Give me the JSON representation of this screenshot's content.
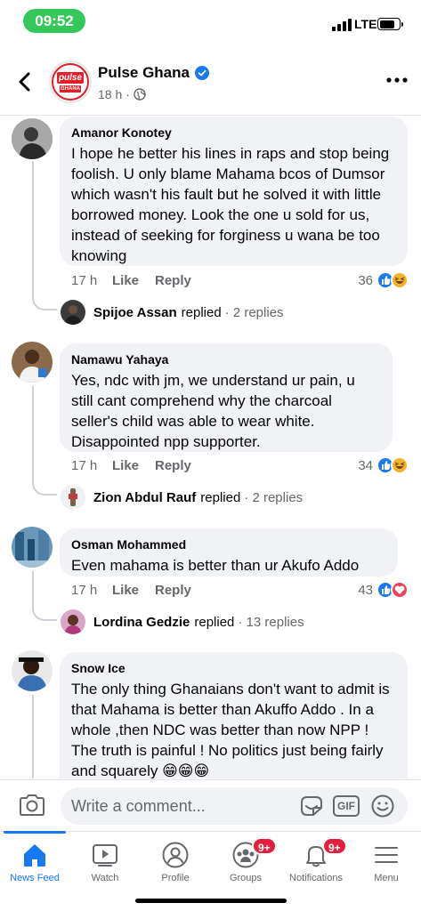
{
  "status_bar": {
    "time": "09:52",
    "network": "LTE"
  },
  "header": {
    "page_name": "Pulse Ghana",
    "logo_text_top": "pulse",
    "logo_text_bottom": "GHANA",
    "time_ago": "18 h",
    "separator": "·"
  },
  "comments": [
    {
      "author": "Amanor Konotey",
      "text": "I hope he better his lines in raps and stop being foolish. U only blame Mahama bcos of Dumsor which wasn't his fault but he solved it with little borrowed money. Look the one u sold for us,  instead of seeking for forginess u wana be too knowing",
      "time": "17 h",
      "like_label": "Like",
      "reply_label": "Reply",
      "reaction_count": "36",
      "reactions": [
        "like",
        "haha"
      ],
      "replier": "Spijoe Assan",
      "replied_label": "replied",
      "reply_count": "· 2 replies"
    },
    {
      "author": "Namawu Yahaya",
      "text": "Yes, ndc with jm, we understand ur pain, u still cant comprehend why the charcoal seller's child was able to wear white. Disappointed npp supporter.",
      "time": "17 h",
      "like_label": "Like",
      "reply_label": "Reply",
      "reaction_count": "34",
      "reactions": [
        "like",
        "haha"
      ],
      "replier": "Zion Abdul Rauf",
      "replied_label": "replied",
      "reply_count": "· 2 replies"
    },
    {
      "author": "Osman Mohammed",
      "text": "Even mahama is better than ur Akufo Addo",
      "time": "17 h",
      "like_label": "Like",
      "reply_label": "Reply",
      "reaction_count": "43",
      "reactions": [
        "like",
        "love"
      ],
      "replier": "Lordina Gedzie",
      "replied_label": "replied",
      "reply_count": "· 13 replies"
    },
    {
      "author": "Snow Ice",
      "text": "The only thing Ghanaians don't want to admit is that Mahama is better than Akuffo Addo . In a whole ,then NDC was better than now NPP ! The truth is painful ! No politics just being fairly and squarely 😁😁😁"
    }
  ],
  "composer": {
    "placeholder": "Write a comment...",
    "gif_label": "GIF"
  },
  "tabs": [
    {
      "label": "News Feed",
      "icon": "home-icon",
      "active": true
    },
    {
      "label": "Watch",
      "icon": "watch-icon"
    },
    {
      "label": "Profile",
      "icon": "profile-icon"
    },
    {
      "label": "Groups",
      "icon": "groups-icon",
      "badge": "9+"
    },
    {
      "label": "Notifications",
      "icon": "bell-icon",
      "badge": "9+"
    },
    {
      "label": "Menu",
      "icon": "menu-icon"
    }
  ],
  "colors": {
    "accent": "#1877f2",
    "badge": "#e41e3f",
    "status_pill": "#34c759",
    "bubble": "#f0f2f5",
    "secondary_text": "#65676b"
  }
}
